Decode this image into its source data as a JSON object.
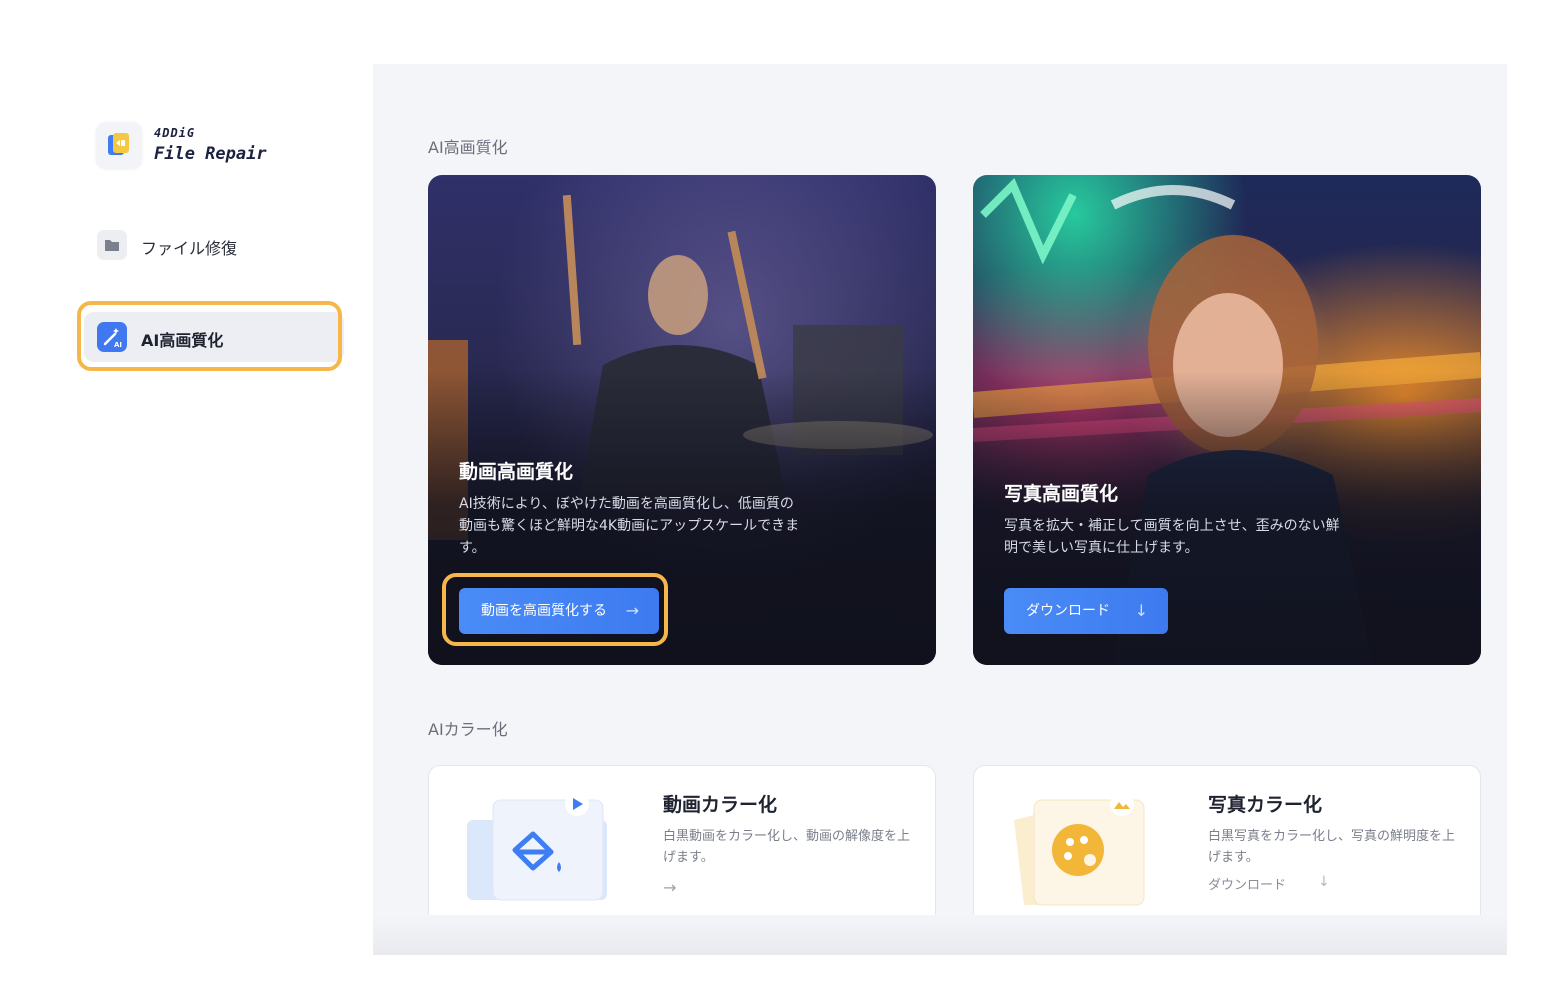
{
  "app": {
    "brand": "4DDiG",
    "name": "File Repair"
  },
  "sidebar": {
    "items": [
      {
        "label": "ファイル修復",
        "icon": "folder-icon"
      },
      {
        "label": "AI高画質化",
        "icon": "ai-wand-icon",
        "active": true
      }
    ]
  },
  "main": {
    "section_enhance": "AI高画質化",
    "section_colorize": "AIカラー化",
    "hero_video": {
      "title": "動画高画質化",
      "desc_lines": [
        "AI技術により、ぼやけた動画を高画質化し、低画質の",
        "動画も驚くほど鮮明な4K動画にアップスケールできま",
        "す。"
      ],
      "button": "動画を高画質化する",
      "button_icon": "→"
    },
    "hero_photo": {
      "title": "写真高画質化",
      "desc_lines": [
        "写真を拡大・補正して画質を向上させ、歪みのない鮮",
        "明で美しい写真に仕上げます。"
      ],
      "button": "ダウンロード",
      "button_icon": "↓"
    },
    "card_video": {
      "title": "動画カラー化",
      "desc": "白黒動画をカラー化し、動画の解像度を上げます。",
      "arrow": "→"
    },
    "card_photo": {
      "title": "写真カラー化",
      "desc": "白黒写真をカラー化し、写真の鮮明度を上げます。",
      "link": "ダウンロード",
      "link_icon": "↓"
    }
  },
  "colors": {
    "accent": "#3f78f0",
    "highlight": "#f6b64a",
    "background": "#f4f5f9"
  }
}
